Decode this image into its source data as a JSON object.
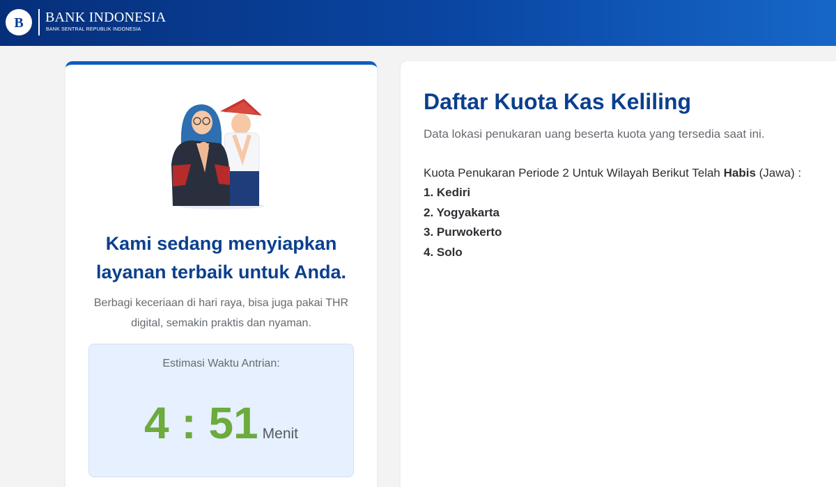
{
  "header": {
    "logo_mark": "B",
    "logo_title": "BANK INDONESIA",
    "logo_subtitle": "BANK SENTRAL REPUBLIK INDONESIA",
    "colors": {
      "start": "#062f7a",
      "end": "#1667c8"
    }
  },
  "left_card": {
    "headline": "Kami sedang menyiapkan layanan terbaik untuk Anda.",
    "subtext": "Berbagi keceriaan di hari raya, bisa juga pakai THR digital, semakin praktis dan nyaman.",
    "queue": {
      "label": "Estimasi Waktu Antrian:",
      "time": "4 : 51",
      "unit": "Menit"
    },
    "accent_color": "#0d5bc7"
  },
  "right_card": {
    "title": "Daftar Kuota Kas Keliling",
    "description": "Data lokasi penukaran uang beserta kuota yang tersedia saat ini.",
    "quota_note_prefix": "Kuota Penukaran Periode 2 Untuk Wilayah Berikut Telah ",
    "quota_note_bold": "Habis",
    "quota_note_suffix": " (Jawa) :",
    "regions": [
      "1. Kediri",
      "2. Yogyakarta",
      "3. Purwokerto",
      "4. Solo"
    ]
  },
  "colors": {
    "title_blue": "#0b3f8e",
    "timer_green": "#6cab3c",
    "queue_bg": "#e6f0fe"
  }
}
